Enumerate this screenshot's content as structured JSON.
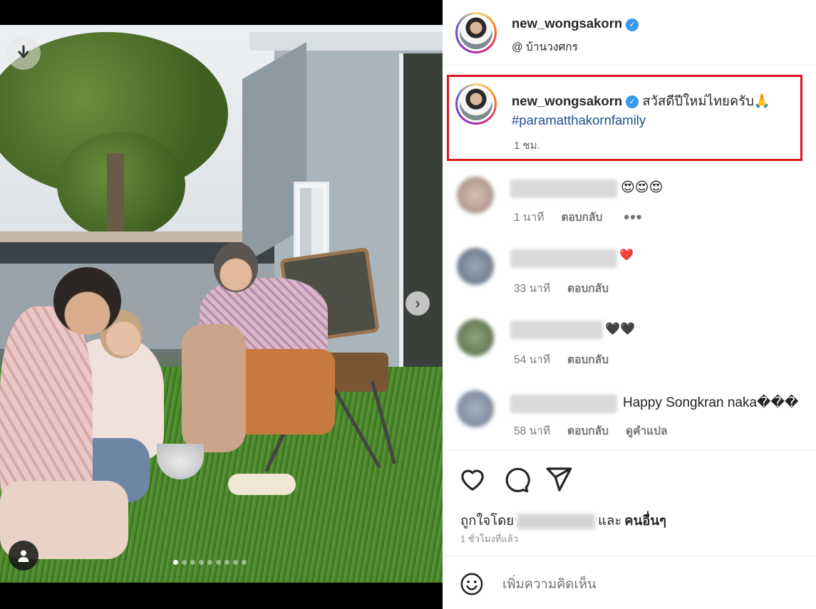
{
  "post": {
    "author": "new_wongsakorn",
    "location": "@ บ้านวงศกร",
    "caption_text": "สวัสดีปีใหม่ไทยครับ🙏",
    "hashtag": "#paramatthakornfamily",
    "caption_time": "1 ชม.",
    "verified_mark": "✓"
  },
  "photo": {
    "download_icon": "download-arrow-icon",
    "next_icon": "chevron-right-icon",
    "next_glyph": "›",
    "user_icon": "user-tag-icon",
    "carousel_count": 9,
    "carousel_active_index": 0
  },
  "comments": [
    {
      "text": "😍😍😍",
      "time": "1 นาที",
      "reply": "ตอบกลับ",
      "more": "•••",
      "translate": ""
    },
    {
      "text": "❤️",
      "time": "33 นาที",
      "reply": "ตอบกลับ",
      "more": "",
      "translate": ""
    },
    {
      "text": "🖤🖤",
      "time": "54 นาที",
      "reply": "ตอบกลับ",
      "more": "",
      "translate": ""
    },
    {
      "text": "Happy Songkran naka���",
      "time": "58 นาที",
      "reply": "ตอบกลับ",
      "more": "",
      "translate": "ดูคำแปล"
    }
  ],
  "actions": {
    "like_icon": "heart-icon",
    "comment_icon": "comment-bubble-icon",
    "share_icon": "paper-plane-icon",
    "liked_by_prefix": "ถูกใจโดย",
    "liked_by_suffix_plain": "และ",
    "liked_by_suffix_bold": "คนอื่นๆ",
    "posted_ago": "1 ชั่วโมงที่แล้ว"
  },
  "add_comment": {
    "emoji_icon": "smiley-icon",
    "placeholder": "เพิ่มความคิดเห็น"
  },
  "colors": {
    "verified": "#3897f0",
    "hashtag": "#1c4f8f",
    "highlight_box": "#e0141c"
  }
}
